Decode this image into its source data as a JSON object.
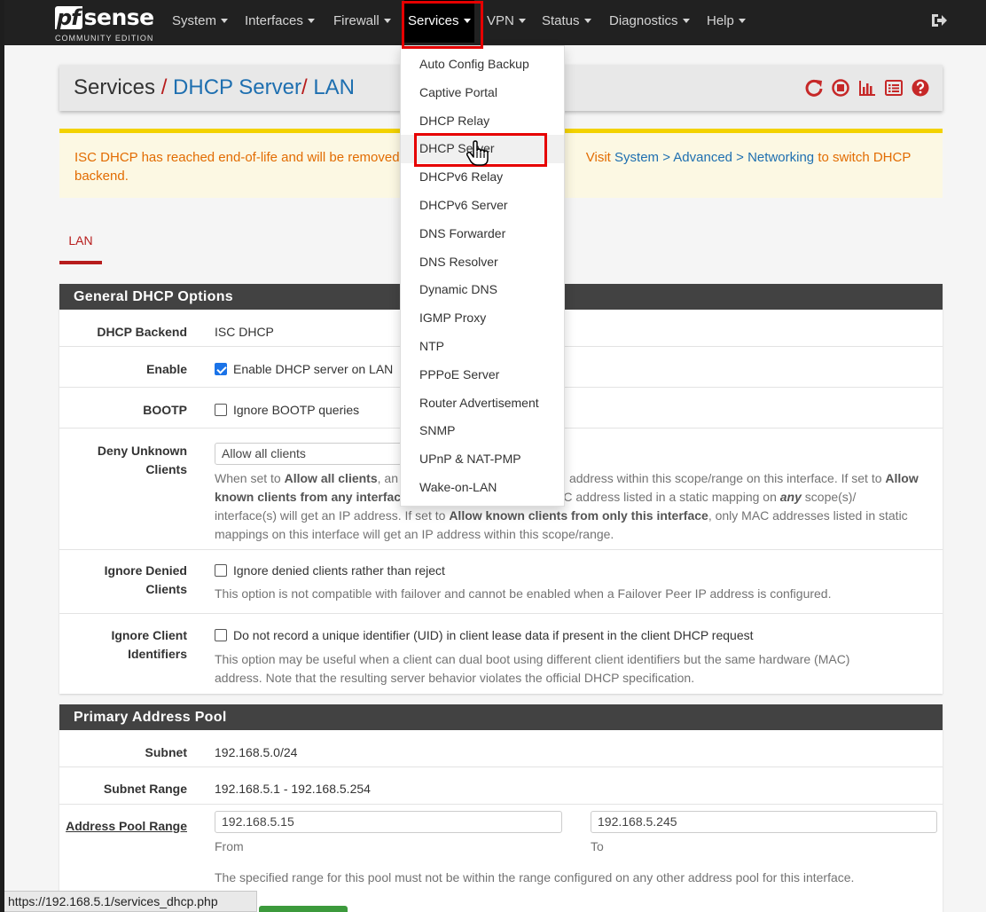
{
  "navbar": {
    "logo_pf": "pf",
    "logo_sense": "sense",
    "logo_sub": "COMMUNITY EDITION",
    "menus": [
      "System",
      "Interfaces",
      "Firewall",
      "Services",
      "VPN",
      "Status",
      "Diagnostics",
      "Help"
    ],
    "active_menu": "Services"
  },
  "breadcrumb": {
    "root": "Services",
    "sep": "/",
    "middle": "DHCP Server",
    "current": "LAN"
  },
  "header_icons": [
    "restart-service-icon",
    "stop-service-icon",
    "status-chart-icon",
    "log-list-icon",
    "help-icon"
  ],
  "alert": {
    "part1": "ISC DHCP has reached end-of-life and will be removed in a future version of Kea",
    "visible_part1": "ISC DHCP has reached end-of-life and will be removed in",
    "visit": "Visit",
    "link": "System > Advanced > Networking",
    "part2": "to switch DHCP",
    "part3": "backend."
  },
  "tabs": [
    "LAN"
  ],
  "general": {
    "heading": "General DHCP Options",
    "backend_label": "DHCP Backend",
    "backend_value": "ISC DHCP",
    "enable_label": "Enable",
    "enable_text": "Enable DHCP server on LAN",
    "bootp_label": "BOOTP",
    "bootp_text": "Ignore BOOTP queries",
    "deny_label_1": "Deny Unknown",
    "deny_label_2": "Clients",
    "deny_select": "Allow all clients",
    "deny_help_1a": "When set to",
    "deny_help_1b": "Allow all clients",
    "deny_help_1c": ", an",
    "deny_help_1d": "address within this scope/range on this interface. If set to",
    "deny_help_1e": "Allow",
    "deny_help_2a": "known clients from any interfac",
    "deny_help_2b": "AC address listed in a static mapping on",
    "deny_help_2c": "any",
    "deny_help_2d": "scope(s)/",
    "deny_help_3a": "interface(s) will get an IP address. If set to",
    "deny_help_3b": "Allow known clients from only this interface",
    "deny_help_3c": ", only MAC addresses listed in static",
    "deny_help_4": "mappings on this interface will get an IP address within this scope/range.",
    "denied_label_1": "Ignore Denied",
    "denied_label_2": "Clients",
    "denied_text": "Ignore denied clients rather than reject",
    "denied_help": "This option is not compatible with failover and cannot be enabled when a Failover Peer IP address is configured.",
    "uid_label_1": "Ignore Client",
    "uid_label_2": "Identifiers",
    "uid_text": "Do not record a unique identifier (UID) in client lease data if present in the client DHCP request",
    "uid_help_1": "This option may be useful when a client can dual boot using different client identifiers but the same hardware (MAC)",
    "uid_help_2": "address. Note that the resulting server behavior violates the official DHCP specification."
  },
  "pool": {
    "heading": "Primary Address Pool",
    "subnet_label": "Subnet",
    "subnet_value": "192.168.5.0/24",
    "range_label": "Subnet Range",
    "range_value": "192.168.5.1 - 192.168.5.254",
    "pool_label": "Address Pool Range",
    "from_value": "192.168.5.15",
    "from_label": "From",
    "to_value": "192.168.5.245",
    "to_label": "To",
    "help": "The specified range for this pool must not be within the range configured on any other address pool for this interface."
  },
  "services_menu": [
    "Auto Config Backup",
    "Captive Portal",
    "DHCP Relay",
    "DHCP Server",
    "DHCPv6 Relay",
    "DHCPv6 Server",
    "DNS Forwarder",
    "DNS Resolver",
    "Dynamic DNS",
    "IGMP Proxy",
    "NTP",
    "PPPoE Server",
    "Router Advertisement",
    "SNMP",
    "UPnP & NAT-PMP",
    "Wake-on-LAN"
  ],
  "statusbar": {
    "url": "https://192.168.5.1/services_dhcp.php"
  },
  "colors": {
    "navbar": "#212121",
    "accent_red": "#b71c1c",
    "link_blue": "#1e6fb0",
    "alert_text": "#e26c02",
    "highlight": "#e60000"
  }
}
